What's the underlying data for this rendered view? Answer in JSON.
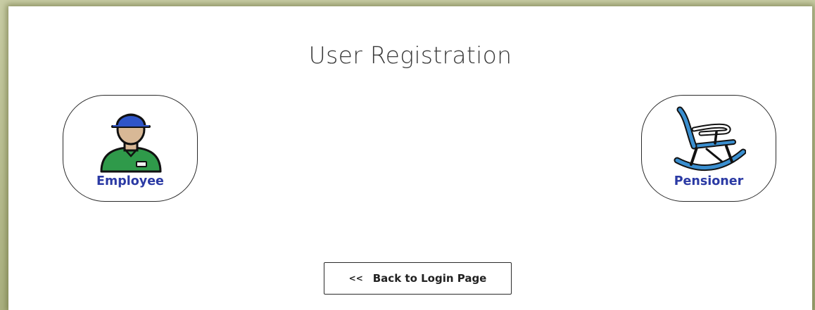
{
  "page": {
    "title": "User Registration"
  },
  "options": [
    {
      "label": "Employee",
      "icon": "employee-icon"
    },
    {
      "label": "Pensioner",
      "icon": "rocking-chair-icon"
    }
  ],
  "back_button": {
    "chevron": "<<",
    "label": "Back to Login Page",
    "icon": "double-chevron-left-icon"
  },
  "colors": {
    "label_blue": "#2b3aa4",
    "cap_blue": "#2f55c8",
    "shirt_green": "#2f9a4a",
    "chair_blue": "#3a8fd0",
    "skin": "#d8b896",
    "frame_olive": "#b3b88e"
  }
}
